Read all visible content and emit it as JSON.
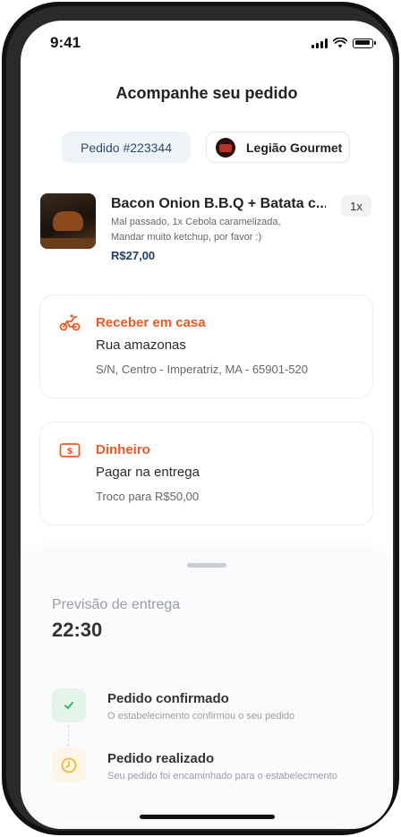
{
  "status_bar": {
    "time": "9:41",
    "signal_icon": "signal-icon",
    "wifi_icon": "wifi-icon",
    "battery_icon": "battery-icon"
  },
  "header": {
    "title": "Acompanhe seu pedido"
  },
  "order": {
    "number_label": "Pedido #223344"
  },
  "store": {
    "name": "Legião Gourmet",
    "logo_icon": "store-logo"
  },
  "item": {
    "name": "Bacon Onion B.B.Q + Batata c...",
    "desc_line1": "Mal passado, 1x Cebola caramelizada,",
    "desc_line2": "Mandar muito ketchup, por favor :)",
    "price": "R$27,00",
    "quantity": "1x",
    "image_icon": "burger-image"
  },
  "delivery": {
    "heading": "Receber em casa",
    "street": "Rua amazonas",
    "address": "S/N, Centro - Imperatriz, MA - 65901-520",
    "icon": "motorcycle-icon"
  },
  "payment": {
    "heading": "Dinheiro",
    "method": "Pagar na entrega",
    "change": "Troco para R$50,00",
    "icon": "cash-icon"
  },
  "tracking": {
    "eta_label": "Previsão de entrega",
    "eta_time": "22:30",
    "steps": [
      {
        "title": "Pedido confirmado",
        "desc": "O estabelecimento confirmou o seu pedido",
        "icon": "check-icon"
      },
      {
        "title": "Pedido realizado",
        "desc": "Seu pedido foi encaminhado para o estabelecimento",
        "icon": "clock-icon"
      }
    ]
  },
  "colors": {
    "accent": "#ee5a24",
    "price": "#223d5e",
    "success": "#34b36b",
    "pending": "#f0b73c"
  }
}
